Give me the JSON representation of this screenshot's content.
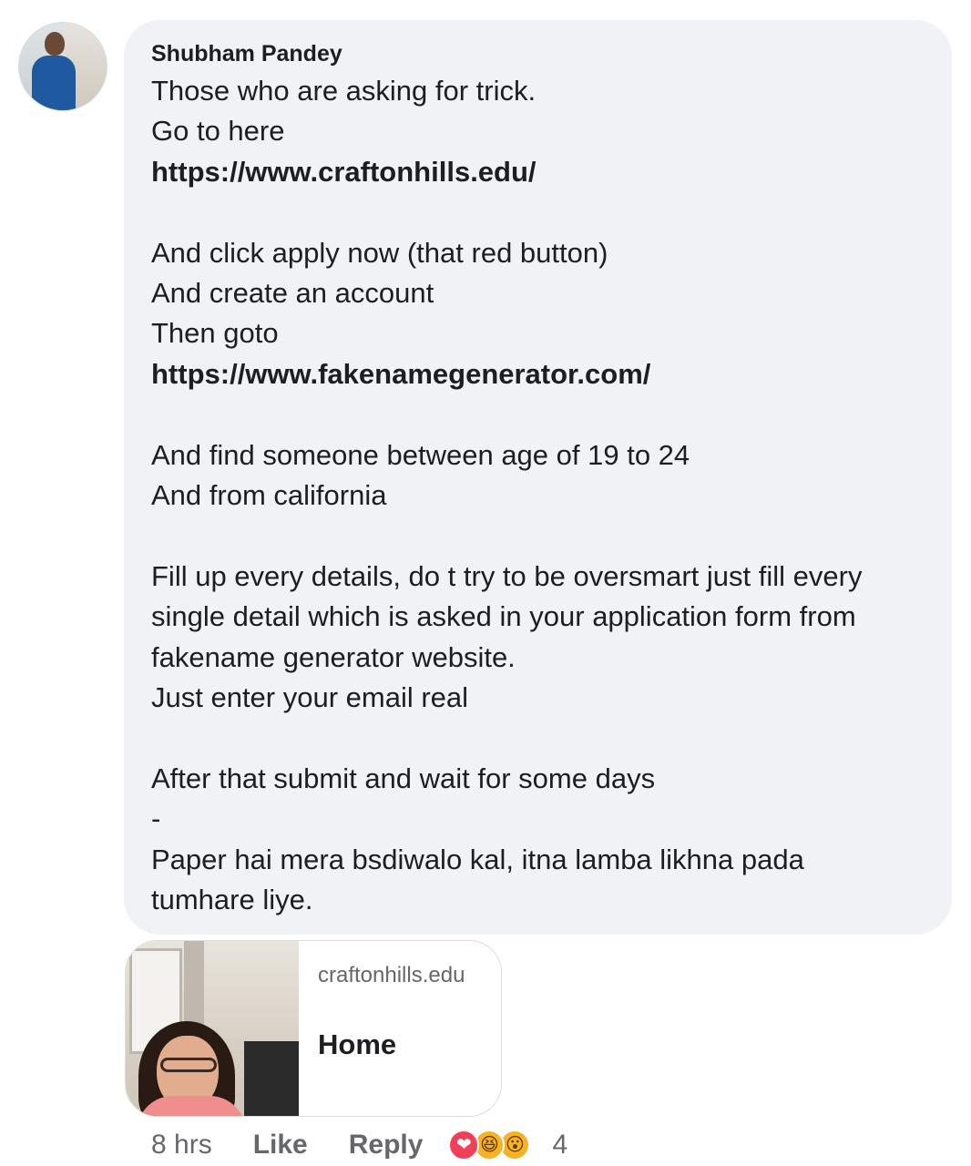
{
  "comment": {
    "author": "Shubham Pandey",
    "lines": [
      {
        "text": "Those who are asking for trick.",
        "link": false
      },
      {
        "text": "Go to here",
        "link": false
      },
      {
        "text": "https://www.craftonhills.edu/",
        "link": true
      },
      {
        "text": "",
        "link": false
      },
      {
        "text": "And click apply now (that red button)",
        "link": false
      },
      {
        "text": "And create an account",
        "link": false
      },
      {
        "text": "Then goto",
        "link": false
      },
      {
        "text": "https://www.fakenamegenerator.com/",
        "link": true
      },
      {
        "text": "",
        "link": false
      },
      {
        "text": "And find someone between age of 19 to 24",
        "link": false
      },
      {
        "text": "And from california",
        "link": false
      },
      {
        "text": "",
        "link": false
      },
      {
        "text": "Fill up every details, do t try to be oversmart just fill every",
        "link": false
      },
      {
        "text": "single detail which is asked in your application form from",
        "link": false
      },
      {
        "text": "fakename generator website.",
        "link": false
      },
      {
        "text": "Just enter your email real",
        "link": false
      },
      {
        "text": "",
        "link": false
      },
      {
        "text": "After that submit and wait for some days",
        "link": false
      },
      {
        "text": "-",
        "link": false
      },
      {
        "text": "Paper hai mera bsdiwalo kal, itna lamba likhna pada",
        "link": false
      },
      {
        "text": "tumhare liye.",
        "link": false
      }
    ]
  },
  "link_preview": {
    "domain": "craftonhills.edu",
    "title": "Home"
  },
  "actions": {
    "time": "8 hrs",
    "like_label": "Like",
    "reply_label": "Reply",
    "reactions": [
      "love-icon",
      "haha-icon",
      "wow-icon"
    ],
    "reaction_count": "4"
  },
  "colors": {
    "bubble_bg": "#f0f2f5",
    "text": "#1c1e21",
    "muted": "#65676b",
    "love": "#f33e58",
    "haha": "#f7b125"
  }
}
